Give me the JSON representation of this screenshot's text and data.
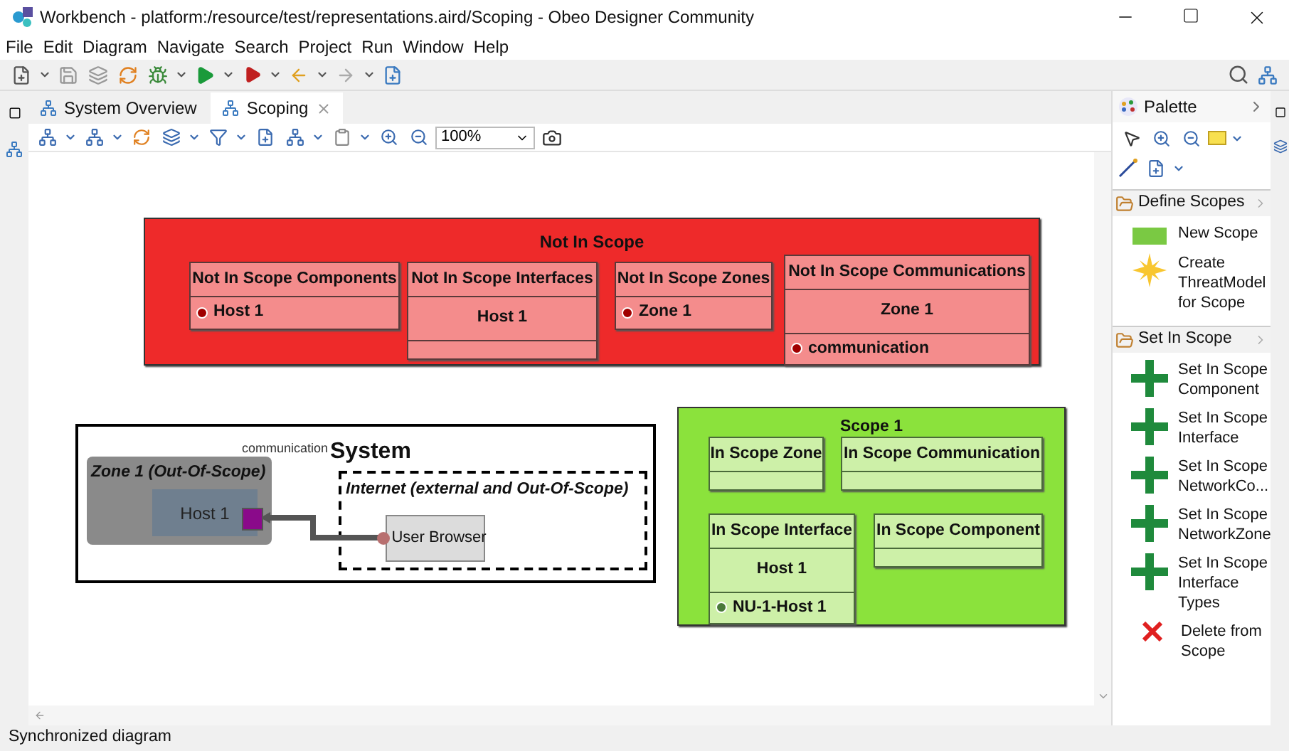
{
  "window": {
    "title": "Workbench - platform:/resource/test/representations.aird/Scoping - Obeo Designer Community"
  },
  "menu": [
    "File",
    "Edit",
    "Diagram",
    "Navigate",
    "Search",
    "Project",
    "Run",
    "Window",
    "Help"
  ],
  "editor_tabs": [
    {
      "label": "System Overview",
      "selected": false
    },
    {
      "label": "Scoping",
      "selected": true
    }
  ],
  "zoom": {
    "value": "100%"
  },
  "not_in_scope": {
    "title": "Not In Scope",
    "compartments": [
      {
        "label": "Not In Scope Components",
        "entries": [
          {
            "kind": "port",
            "label": "Host 1"
          }
        ]
      },
      {
        "label": "Not In Scope Interfaces",
        "entries": [
          {
            "kind": "name",
            "label": "Host 1"
          }
        ]
      },
      {
        "label": "Not In Scope Zones",
        "entries": [
          {
            "kind": "port",
            "label": "Zone 1"
          }
        ]
      },
      {
        "label": "Not In Scope Communications",
        "entries": [
          {
            "kind": "name",
            "label": "Zone 1"
          },
          {
            "kind": "port",
            "label": "communication"
          }
        ]
      }
    ]
  },
  "system": {
    "title": "System",
    "zone": "Zone 1 (Out-Of-Scope)",
    "host": "Host 1",
    "link_label": "communication",
    "internet": "Internet (external and Out-Of-Scope)",
    "browser": "User Browser"
  },
  "scope": {
    "title": "Scope 1",
    "compartments": [
      {
        "label": "In Scope Zone"
      },
      {
        "label": "In Scope Communication"
      },
      {
        "label": "In Scope Interface",
        "entries": [
          {
            "kind": "name",
            "label": "Host 1"
          },
          {
            "kind": "port",
            "label": "NU-1-Host 1"
          }
        ]
      },
      {
        "label": "In Scope Component"
      }
    ]
  },
  "palette": {
    "title": "Palette",
    "drawers": [
      {
        "label": "Define Scopes",
        "items": [
          {
            "kind": "scope",
            "label": "New Scope"
          },
          {
            "kind": "star",
            "label": "Create ThreatModel for Scope"
          }
        ]
      },
      {
        "label": "Set In Scope",
        "items": [
          {
            "kind": "plus",
            "label": "Set In Scope Component"
          },
          {
            "kind": "plus",
            "label": "Set In Scope Interface"
          },
          {
            "kind": "plus",
            "label": "Set In Scope NetworkCo..."
          },
          {
            "kind": "plus",
            "label": "Set In Scope NetworkZone"
          },
          {
            "kind": "plus",
            "label": "Set In Scope Interface Types"
          },
          {
            "kind": "cross",
            "label": "Delete from Scope"
          }
        ]
      }
    ]
  },
  "status_bar": "Synchronized diagram"
}
